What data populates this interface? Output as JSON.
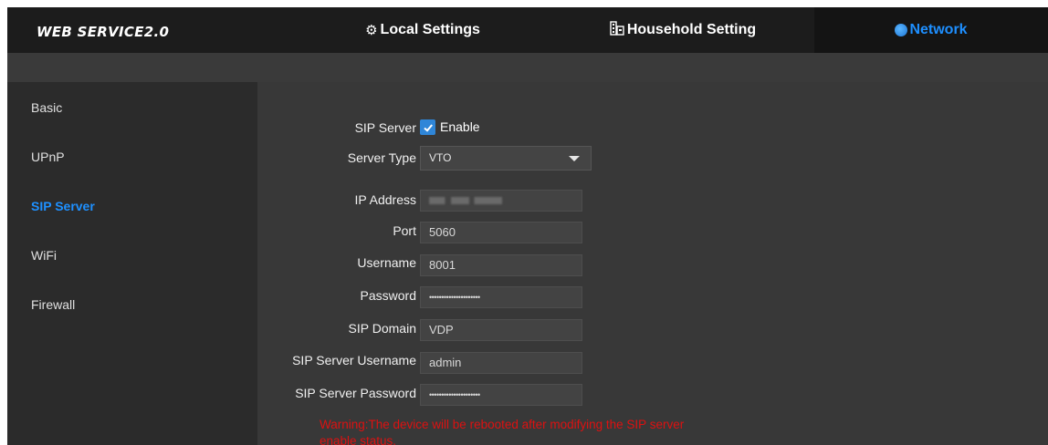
{
  "header": {
    "brand": "WEB SERVICE2.0",
    "tabs": [
      {
        "label": "Local Settings",
        "icon": "gear-icon"
      },
      {
        "label": "Household Setting",
        "icon": "building-icon"
      },
      {
        "label": "Network",
        "icon": "globe-icon",
        "active": true
      }
    ]
  },
  "sidebar": {
    "items": [
      {
        "label": "Basic"
      },
      {
        "label": "UPnP"
      },
      {
        "label": "SIP Server",
        "active": true
      },
      {
        "label": "WiFi"
      },
      {
        "label": "Firewall"
      }
    ]
  },
  "form": {
    "sip_server": {
      "label": "SIP Server",
      "checkbox_label": "Enable",
      "checked": true
    },
    "server_type": {
      "label": "Server Type",
      "value": "VTO"
    },
    "ip_address": {
      "label": "IP Address"
    },
    "port": {
      "label": "Port",
      "value": "5060"
    },
    "username": {
      "label": "Username",
      "value": "8001"
    },
    "password": {
      "label": "Password",
      "value": "•••••••••••••••••••••"
    },
    "sip_domain": {
      "label": "SIP Domain",
      "value": "VDP"
    },
    "sip_server_username": {
      "label": "SIP Server Username",
      "value": "admin"
    },
    "sip_server_password": {
      "label": "SIP Server Password",
      "value": "•••••••••••••••••••••"
    },
    "warning": "Warning:The device will be rebooted after modifying the SIP server enable status."
  },
  "colors": {
    "accent": "#1e90ff",
    "warning": "#dd1111",
    "checkbox": "#2f86d8"
  }
}
